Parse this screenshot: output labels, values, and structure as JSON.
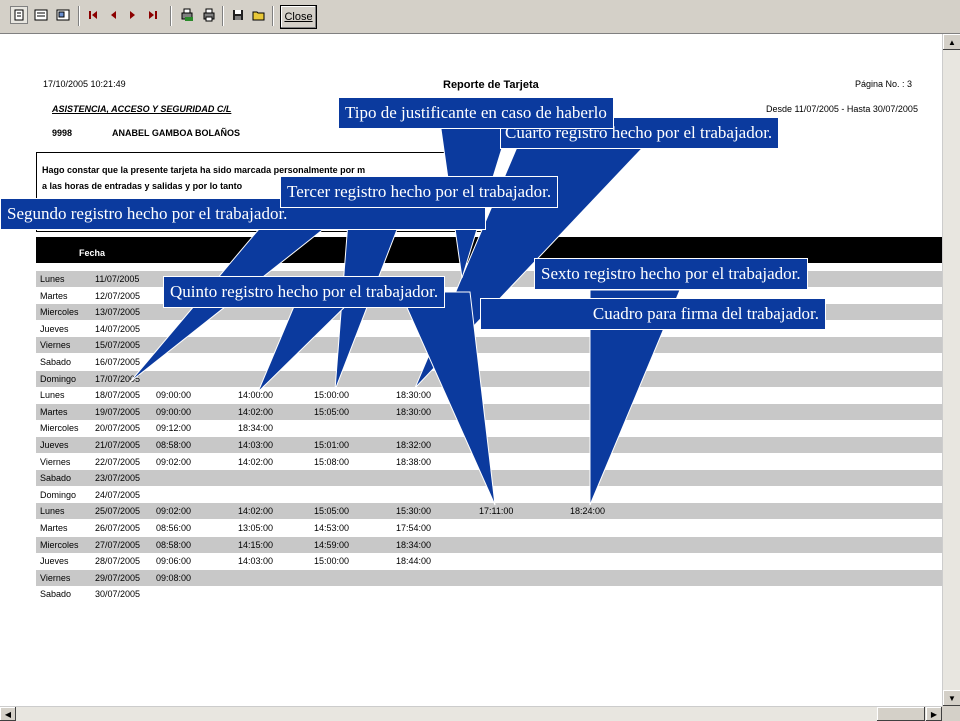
{
  "toolbar": {
    "close_label": "Close",
    "icons": [
      "page-icon",
      "two-pages-icon",
      "zoom-icon",
      "first-page-icon",
      "prev-page-icon",
      "next-page-icon",
      "last-page-icon",
      "print-setup-icon",
      "print-icon",
      "save-icon",
      "open-icon"
    ]
  },
  "report": {
    "datetime": "17/10/2005 10:21:49",
    "title": "Reporte de Tarjeta",
    "page": "Página No. : 3",
    "company": "ASISTENCIA, ACCESO Y SEGURIDAD C/L",
    "range": "Desde 11/07/2005 - Hasta 30/07/2005",
    "employee_id": "9998",
    "employee_name": "ANABEL GAMBOA BOLAÑOS",
    "legal_line1": "Hago constar que la presente tarjeta ha sido marcada personalmente por m",
    "legal_line2": "a las horas de entradas y salidas y por lo tanto",
    "fecha_header": "Fecha",
    "rows": [
      {
        "day": "Lunes",
        "date": "11/07/2005",
        "t": [
          "",
          "",
          "",
          "",
          "",
          ""
        ]
      },
      {
        "day": "Martes",
        "date": "12/07/2005",
        "t": [
          "",
          "",
          "",
          "",
          "",
          ""
        ]
      },
      {
        "day": "Miercoles",
        "date": "13/07/2005",
        "t": [
          "",
          "",
          "",
          "",
          "",
          ""
        ]
      },
      {
        "day": "Jueves",
        "date": "14/07/2005",
        "t": [
          "",
          "",
          "",
          "",
          "",
          ""
        ]
      },
      {
        "day": "Viernes",
        "date": "15/07/2005",
        "t": [
          "",
          "",
          "",
          "",
          "",
          ""
        ]
      },
      {
        "day": "Sabado",
        "date": "16/07/2005",
        "t": [
          "",
          "",
          "",
          "",
          "",
          ""
        ]
      },
      {
        "day": "Domingo",
        "date": "17/07/2005",
        "t": [
          "",
          "",
          "",
          "",
          "",
          ""
        ]
      },
      {
        "day": "Lunes",
        "date": "18/07/2005",
        "t": [
          "09:00:00",
          "14:00:00",
          "15:00:00",
          "18:30:00",
          "",
          ""
        ]
      },
      {
        "day": "Martes",
        "date": "19/07/2005",
        "t": [
          "09:00:00",
          "14:02:00",
          "15:05:00",
          "18:30:00",
          "",
          ""
        ]
      },
      {
        "day": "Miercoles",
        "date": "20/07/2005",
        "t": [
          "09:12:00",
          "18:34:00",
          "",
          "",
          "",
          ""
        ]
      },
      {
        "day": "Jueves",
        "date": "21/07/2005",
        "t": [
          "08:58:00",
          "14:03:00",
          "15:01:00",
          "18:32:00",
          "",
          ""
        ]
      },
      {
        "day": "Viernes",
        "date": "22/07/2005",
        "t": [
          "09:02:00",
          "14:02:00",
          "15:08:00",
          "18:38:00",
          "",
          ""
        ]
      },
      {
        "day": "Sabado",
        "date": "23/07/2005",
        "t": [
          "",
          "",
          "",
          "",
          "",
          ""
        ]
      },
      {
        "day": "Domingo",
        "date": "24/07/2005",
        "t": [
          "",
          "",
          "",
          "",
          "",
          ""
        ]
      },
      {
        "day": "Lunes",
        "date": "25/07/2005",
        "t": [
          "09:02:00",
          "14:02:00",
          "15:05:00",
          "15:30:00",
          "17:11:00",
          "18:24:00"
        ]
      },
      {
        "day": "Martes",
        "date": "26/07/2005",
        "t": [
          "08:56:00",
          "13:05:00",
          "14:53:00",
          "17:54:00",
          "",
          ""
        ]
      },
      {
        "day": "Miercoles",
        "date": "27/07/2005",
        "t": [
          "08:58:00",
          "14:15:00",
          "14:59:00",
          "18:34:00",
          "",
          ""
        ]
      },
      {
        "day": "Jueves",
        "date": "28/07/2005",
        "t": [
          "09:06:00",
          "14:03:00",
          "15:00:00",
          "18:44:00",
          "",
          ""
        ]
      },
      {
        "day": "Viernes",
        "date": "29/07/2005",
        "t": [
          "09:08:00",
          "",
          "",
          "",
          "",
          ""
        ]
      },
      {
        "day": "Sabado",
        "date": "30/07/2005",
        "t": [
          "",
          "",
          "",
          "",
          "",
          ""
        ]
      }
    ]
  },
  "callouts": {
    "justificante": "Tipo de justificante en caso de haberlo",
    "cuarto": "Cuarto registro hecho por el  trabajador.",
    "tercer": "Tercer registro hecho por el trabajador.",
    "segundo": "Segundo  registro hecho por el  trabajador.",
    "sexto": "Sexto registro hecho por el  trabajador.",
    "quinto": "Quinto registro hecho por el  trabajador.",
    "firma": "Cuadro para firma del trabajador."
  },
  "colors": {
    "callout_fill": "#0b3a9e",
    "row_shade": "#c8c8c8",
    "header": "#000000"
  }
}
